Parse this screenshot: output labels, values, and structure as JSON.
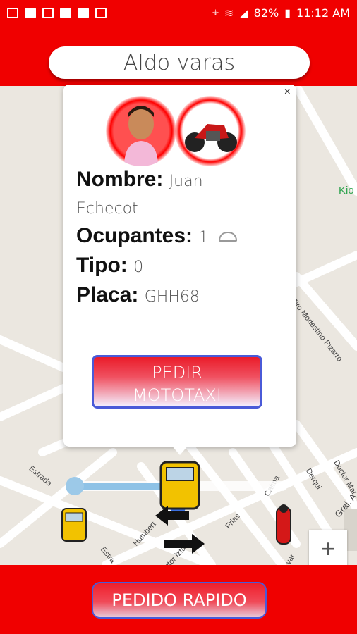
{
  "status_bar": {
    "battery": "82%",
    "time": "11:12 AM"
  },
  "header": {
    "search_value": "Aldo varas"
  },
  "map": {
    "labels": [
      "Kio",
      "Jiro Modestino Pizarro",
      "Estrada",
      "Estra",
      "Humbert",
      "ntor Iztar",
      "Frias",
      "Calma",
      "Derqui",
      "Doctor Mar",
      "Gral. A",
      "var"
    ]
  },
  "driver_card": {
    "nombre_label": "Nombre:",
    "nombre_value_first": "Juan",
    "nombre_value_last": "Echecot",
    "ocupantes_label": "Ocupantes:",
    "ocupantes_value": "1",
    "tipo_label": "Tipo:",
    "tipo_value": "0",
    "placa_label": "Placa:",
    "placa_value": "GHH68",
    "close_label": "×",
    "pedir_line1": "PEDIR",
    "pedir_line2": "MOTOTAXI"
  },
  "bottom": {
    "pedido_rapido": "PEDIDO RAPIDO"
  },
  "zoom": {
    "plus": "+"
  },
  "colors": {
    "brand_red": "#f00000",
    "button_border": "#4a5ad8"
  }
}
